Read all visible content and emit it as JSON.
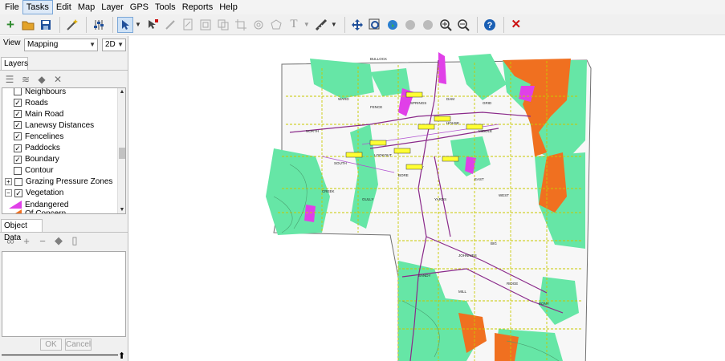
{
  "menu": [
    "File",
    "Tasks",
    "Edit",
    "Map",
    "Layer",
    "GPS",
    "Tools",
    "Reports",
    "Help"
  ],
  "menu_active": "Tasks",
  "toolbar": {
    "icons": [
      "add-icon",
      "open-folder-icon",
      "save-icon",
      "magic-wand-icon",
      "sliders-icon",
      "select-arrow-icon",
      "pointer-edit-icon",
      "pencil-icon",
      "edit-page-icon",
      "frame-icon",
      "copy-icon",
      "crop-icon",
      "shape-icon",
      "polygon-icon",
      "text-tool-icon",
      "measure-icon",
      "pan-icon",
      "zoom-extent-icon",
      "globe-icon",
      "globe-refresh-icon",
      "zoom-in-icon",
      "zoom-out-icon",
      "help-icon",
      "close-icon"
    ],
    "colors": {
      "add": "#2e8b2e",
      "help": "#1a5fb4",
      "close": "#cc1111",
      "folder": "#e3a32a",
      "save": "#1f4f9a"
    }
  },
  "view": {
    "label": "View",
    "mode": "Mapping",
    "dimension": "2D"
  },
  "layers_panel": {
    "tab": "Layers",
    "items": [
      {
        "label": "Neighbours",
        "checked": false
      },
      {
        "label": "Roads",
        "checked": true
      },
      {
        "label": "Main Road",
        "checked": true
      },
      {
        "label": "Lanewsy Distances",
        "checked": true
      },
      {
        "label": "Fencelines",
        "checked": true
      },
      {
        "label": "Paddocks",
        "checked": true
      },
      {
        "label": "Boundary",
        "checked": true
      },
      {
        "label": "Contour",
        "checked": false
      },
      {
        "label": "Grazing Pressure Zones",
        "checked": false
      },
      {
        "label": "Vegetation",
        "checked": true
      }
    ],
    "legend": [
      {
        "label": "Endangered",
        "color": "#e040e8"
      },
      {
        "label": "Of Concern",
        "color": "#f07020"
      }
    ]
  },
  "object_data": {
    "tab": "Object Data",
    "ok": "OK",
    "cancel": "Cancel"
  },
  "map_colors": {
    "vegetation": "#66e6a6",
    "endangered": "#e040e8",
    "of_concern": "#f07020",
    "boundary": "#707070",
    "fence": "#c8c800",
    "road": "#8a2a8a",
    "label_box": "#ffff33"
  },
  "paddock_labels": [
    "BULLOCK",
    "WARD",
    "FENCE",
    "SPRINGS",
    "DAM",
    "GRID",
    "HOUSE",
    "MIDDLE",
    "NORTH",
    "SOUTH",
    "LOOKOUT",
    "SCRUBBY",
    "CREEK",
    "GULLY",
    "BORE",
    "YARDS",
    "EAST",
    "WEST",
    "BIG",
    "JOHNNIES",
    "SANDY",
    "MILL",
    "RIDGE",
    "PONY"
  ]
}
